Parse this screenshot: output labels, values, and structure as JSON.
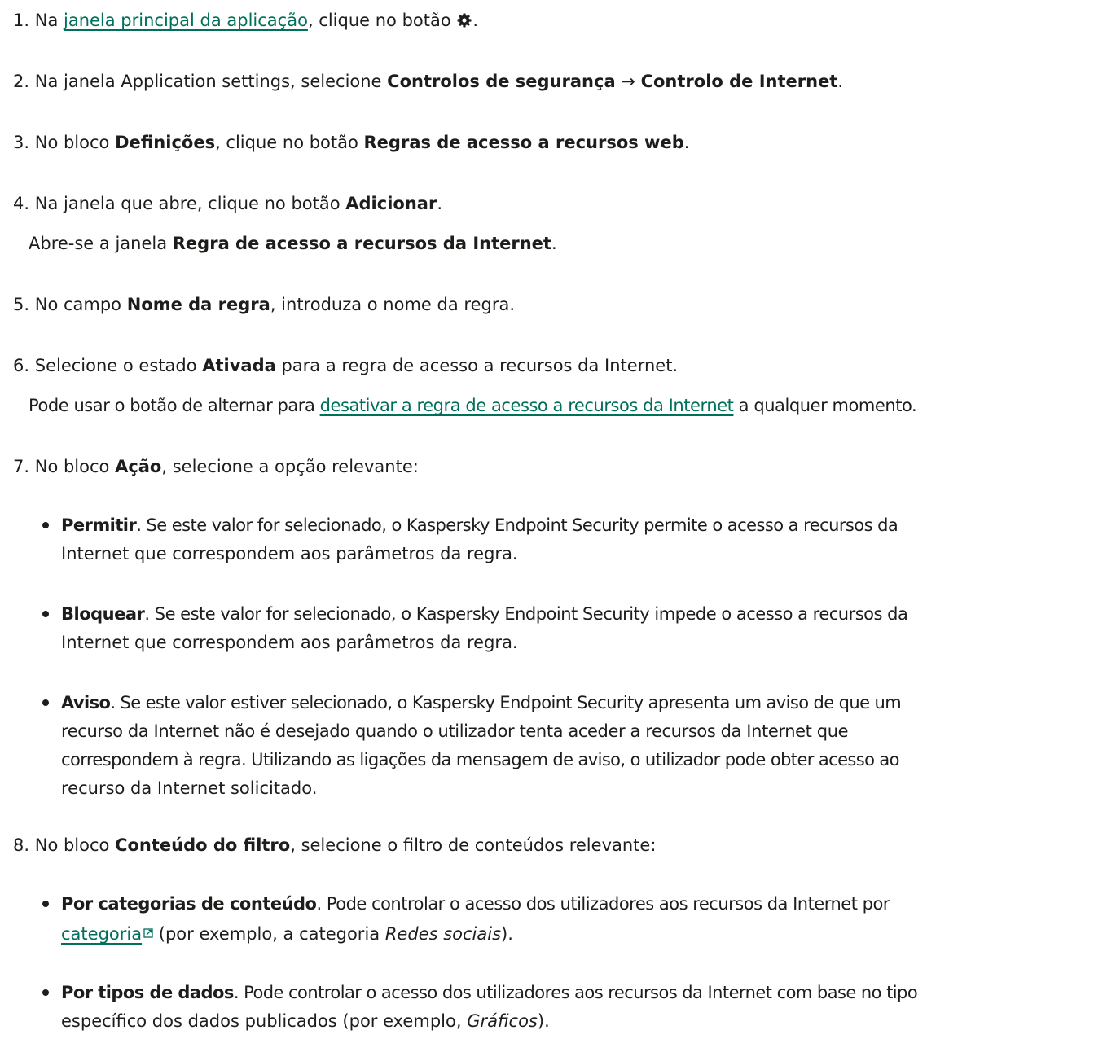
{
  "steps": {
    "s1": {
      "num": "1.",
      "pre": "Na ",
      "link": "janela principal da aplicação",
      "post": ", clique no botão ",
      "icon": "gear-icon",
      "end": "."
    },
    "s2": {
      "num": "2.",
      "pre": "Na janela Application settings, selecione ",
      "b1": "Controlos de segurança",
      "arrow": " → ",
      "b2": "Controlo de Internet",
      "end": "."
    },
    "s3": {
      "num": "3.",
      "pre": "No bloco ",
      "b1": "Definições",
      "mid": ", clique no botão ",
      "b2": "Regras de acesso a recursos web",
      "end": "."
    },
    "s4": {
      "num": "4.",
      "pre": "Na janela que abre, clique no botão ",
      "b1": "Adicionar",
      "end": ".",
      "note_pre": "Abre-se a janela ",
      "note_b": "Regra de acesso a recursos da Internet",
      "note_end": "."
    },
    "s5": {
      "num": "5.",
      "pre": "No campo ",
      "b1": "Nome da regra",
      "post": ", introduza o nome da regra."
    },
    "s6": {
      "num": "6.",
      "pre": "Selecione o estado ",
      "b1": "Ativada",
      "post": " para a regra de acesso a recursos da Internet.",
      "note_pre": "Pode usar o botão de alternar para ",
      "note_link": "desativar a regra de acesso a recursos da Internet",
      "note_post": " a qualquer momento."
    },
    "s7": {
      "num": "7.",
      "pre": "No bloco ",
      "b1": "Ação",
      "post": ", selecione a opção relevante:",
      "options": [
        {
          "title": "Permitir",
          "l1": ". Se este valor for selecionado, o Kaspersky Endpoint Security permite o acesso a recursos da",
          "l2": "Internet que correspondem aos parâmetros da regra."
        },
        {
          "title": "Bloquear",
          "l1": ". Se este valor for selecionado, o Kaspersky Endpoint Security impede o acesso a recursos da",
          "l2": "Internet que correspondem aos parâmetros da regra."
        },
        {
          "title": "Aviso",
          "l1": ". Se este valor estiver selecionado, o Kaspersky Endpoint Security apresenta um aviso de que um",
          "l2": "recurso da Internet não é desejado quando o utilizador tenta aceder a recursos da Internet que",
          "l3": "correspondem à regra. Utilizando as ligações da mensagem de aviso, o utilizador pode obter acesso ao",
          "l4": "recurso da Internet solicitado."
        }
      ]
    },
    "s8": {
      "num": "8.",
      "pre": "No bloco ",
      "b1": "Conteúdo do filtro",
      "post": ", selecione o filtro de conteúdos relevante:",
      "options": [
        {
          "title": "Por categorias de conteúdo",
          "l1": ". Pode controlar o acesso dos utilizadores aos recursos da Internet por",
          "link": "categoria",
          "l2_post": " (por exemplo, a categoria ",
          "l2_it": "Redes sociais",
          "l2_end": ")."
        },
        {
          "title": "Por tipos de dados",
          "l1": ". Pode controlar o acesso dos utilizadores aos recursos da Internet com base no tipo",
          "l2_pre": "específico dos dados publicados (por exemplo, ",
          "l2_it": "Gráficos",
          "l2_end": ")."
        }
      ]
    }
  },
  "colors": {
    "text": "#1d1d1b",
    "link": "#00705a",
    "background": "#ffffff"
  }
}
